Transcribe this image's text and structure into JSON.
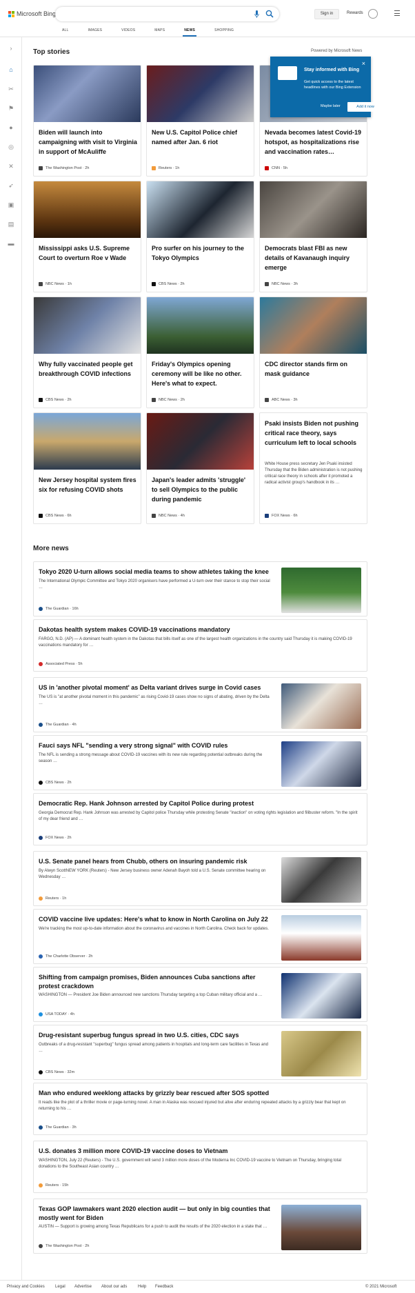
{
  "app": {
    "logo_text": "Microsoft Bing",
    "signin": "Sign in",
    "rewards": "Rewards"
  },
  "tabs": [
    "ALL",
    "IMAGES",
    "VIDEOS",
    "MAPS",
    "NEWS",
    "SHOPPING"
  ],
  "active_tab": "NEWS",
  "top_stories": {
    "heading": "Top stories",
    "powered": "Powered by Microsoft News"
  },
  "popup": {
    "title": "Stay informed with Bing",
    "desc": "Get quick access to the latest headlines with our Bing Extension",
    "later": "Maybe later",
    "add": "Add it now",
    "close": "×"
  },
  "stories": [
    {
      "title": "Biden will launch into campaigning with visit to Virginia in support of McAuliffe",
      "source": "The Washington Post",
      "time": "2h"
    },
    {
      "title": "New U.S. Capitol Police chief named after Jan. 6 riot",
      "source": "Reuters",
      "time": "1h"
    },
    {
      "title": "Nevada becomes latest Covid-19 hotspot, as hospitalizations rise and vaccination rates…",
      "source": "CNN",
      "time": "5h"
    },
    {
      "title": "Mississippi asks U.S. Supreme Court to overturn Roe v Wade",
      "source": "NBC News",
      "time": "1h"
    },
    {
      "title": "Pro surfer on his journey to the Tokyo Olympics",
      "source": "CBS News",
      "time": "2h"
    },
    {
      "title": "Democrats blast FBI as new details of Kavanaugh inquiry emerge",
      "source": "NBC News",
      "time": "3h"
    },
    {
      "title": "Why fully vaccinated people get breakthrough COVID infections",
      "source": "CBS News",
      "time": "2h"
    },
    {
      "title": "Friday's Olympics opening ceremony will be like no other. Here's what to expect.",
      "source": "NBC News",
      "time": "2h"
    },
    {
      "title": "CDC director stands firm on mask guidance",
      "source": "ABC News",
      "time": "3h"
    },
    {
      "title": "New Jersey hospital system fires six for refusing COVID shots",
      "source": "CBS News",
      "time": "6h"
    },
    {
      "title": "Japan's leader admits 'struggle' to sell Olympics to the public during pandemic",
      "source": "NBC News",
      "time": "4h"
    },
    {
      "title": "Psaki insists Biden not pushing critical race theory, says curriculum left to local schools",
      "body": "White House press secretary Jen Psaki insisted Thursday that the Biden administration is not pushing critical race theory in schools after it promoted a radical activist group's handbook in its …",
      "source": "FOX News",
      "time": "6h"
    }
  ],
  "more_news": {
    "heading": "More news"
  },
  "news": [
    {
      "title": "Tokyo 2020 U-turn allows social media teams to show athletes taking the knee",
      "desc": "The International Olympic Committee and Tokyo 2020 organisers have performed a U-turn over their stance to stop their social …",
      "source": "The Guardian",
      "time": "16h"
    },
    {
      "title": "Dakotas health system makes COVID-19 vaccinations mandatory",
      "desc": "FARGO, N.D. (AP) — A dominant health system in the Dakotas that bills itself as one of the largest health organizations in the country said Thursday it is making COVID-19 vaccinations mandatory for …",
      "source": "Associated Press",
      "time": "5h"
    },
    {
      "title": "US in 'another pivotal moment' as Delta variant drives surge in Covid cases",
      "desc": "The US is \"at another pivotal moment in this pandemic\" as rising Covid-19 cases show no signs of abating, driven by the Delta …",
      "source": "The Guardian",
      "time": "4h"
    },
    {
      "title": "Fauci says NFL \"sending a very strong signal\" with COVID rules",
      "desc": "The NFL is sending a strong message about COVID-19 vaccines with its new rule regarding potential outbreaks during the season …",
      "source": "CBS News",
      "time": "2h"
    },
    {
      "title": "Democratic Rep. Hank Johnson arrested by Capitol Police during protest",
      "desc": "Georgia Democrat Rep. Hank Johnson was arrested by Capitol police Thursday while protesting Senate \"inaction\" on voting rights legislation and filibuster reform. \"In the spirit of my dear friend and …",
      "source": "FOX News",
      "time": "2h"
    },
    {
      "title": "U.S. Senate panel hears from Chubb, others on insuring pandemic risk",
      "desc": "By Alwyn ScottNEW YORK (Reuters) - New Jersey business owner Adenah Bayoh told a U.S. Senate committee hearing on Wednesday …",
      "source": "Reuters",
      "time": "1h"
    },
    {
      "title": "COVID vaccine live updates: Here's what to know in North Carolina on July 22",
      "desc": "We're tracking the most up-to-date information about the coronavirus and vaccines in North Carolina. Check back for updates.",
      "source": "The Charlotte Observer",
      "time": "2h"
    },
    {
      "title": "Shifting from campaign promises, Biden announces Cuba sanctions after protest crackdown",
      "desc": "WASHINGTON — President Joe Biden announced new sanctions Thursday targeting a top Cuban military official and a …",
      "source": "USA TODAY",
      "time": "4h"
    },
    {
      "title": "Drug-resistant superbug fungus spread in two U.S. cities, CDC says",
      "desc": "Outbreaks of a drug-resistant \"superbug\" fungus spread among patients in hospitals and long-term care facilities in Texas and …",
      "source": "CBS News",
      "time": "32m"
    },
    {
      "title": "Man who endured weeklong attacks by grizzly bear rescued after SOS spotted",
      "desc": "It reads like the plot of a thriller movie or page-turning novel. A man in Alaska was rescued injured but alive after enduring repeated attacks by a grizzly bear that kept on returning to his …",
      "source": "The Guardian",
      "time": "3h"
    },
    {
      "title": "U.S. donates 3 million more COVID-19 vaccine doses to Vietnam",
      "desc": "WASHINGTON, July 22 (Reuters) - The U.S. government will send 3 million more doses of the Moderna Inc COVID-19 vaccine to Vietnam on Thursday, bringing total donations to the Southeast Asian country …",
      "source": "Reuters",
      "time": "15h"
    },
    {
      "title": "Texas GOP lawmakers want 2020 election audit — but only in big counties that mostly went for Biden",
      "desc": "AUSTIN — Support is growing among Texas Republicans for a push to audit the results of the 2020 election in a state that …",
      "source": "The Washington Post",
      "time": "2h"
    }
  ],
  "footer": [
    "Privacy and Cookies",
    "Legal",
    "Advertise",
    "About our ads",
    "Help",
    "Feedback"
  ],
  "copyright": "© 2021 Microsoft"
}
